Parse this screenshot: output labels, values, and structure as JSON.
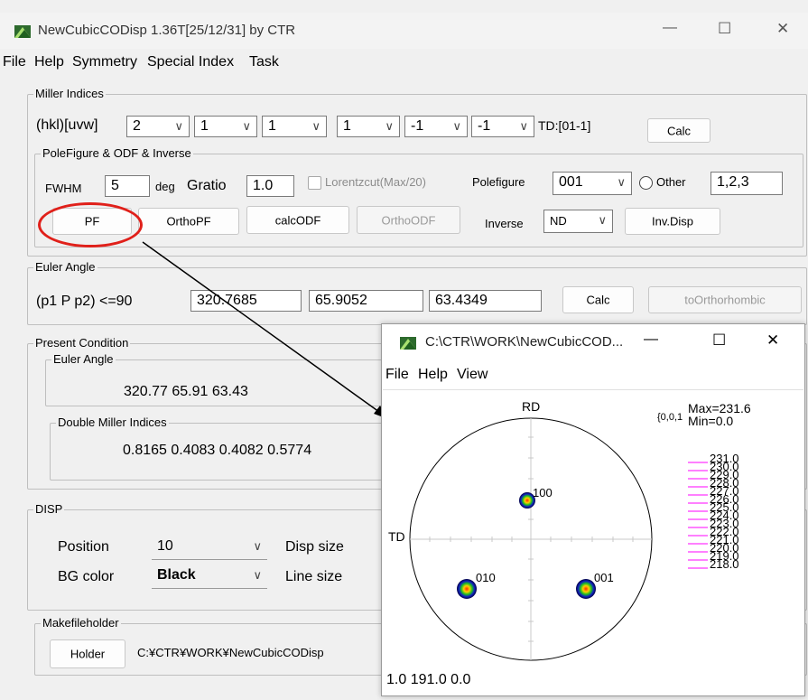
{
  "window": {
    "title": "NewCubicCODisp 1.36T[25/12/31] by CTR",
    "controls": {
      "minimize": "—",
      "maximize": "☐",
      "close": "✕"
    }
  },
  "menu": [
    "File",
    "Help",
    "Symmetry",
    "Special Index",
    "Task"
  ],
  "miller": {
    "group_title": "Miller Indices",
    "label": "(hkl)[uvw]",
    "values": [
      "2",
      "1",
      "1",
      "1",
      "-1",
      "-1"
    ],
    "td": "TD:[01-1]",
    "calc": "Calc"
  },
  "pole": {
    "group_title": "PoleFigure & ODF & Inverse",
    "fwhm_label": "FWHM",
    "fwhm_value": "5",
    "deg": "deg",
    "gratio_label": "Gratio",
    "gratio_value": "1.0",
    "lorentz_label": "Lorentzcut(Max/20)",
    "polefigure_label": "Polefigure",
    "polefigure_value": "001",
    "other_label": "Other",
    "other_value": "1,2,3",
    "pf": "PF",
    "orthopf": "OrthoPF",
    "calcodf": "calcODF",
    "orthoodf": "OrthoODF",
    "inverse_label": "Inverse",
    "inverse_value": "ND",
    "invdisp": "Inv.Disp"
  },
  "euler": {
    "group_title": "Euler Angle",
    "label": "(p1 P p2) <=90",
    "values": [
      "320.7685",
      "65.9052",
      "63.4349"
    ],
    "calc": "Calc",
    "to_ortho": "toOrthorhombic"
  },
  "present": {
    "group_title": "Present Condition",
    "euler_title": "Euler Angle",
    "euler_text": "320.77  65.91  63.43",
    "dmi_title": "Double Miller Indices",
    "dmi_text": "0.8165  0.4083  0.4082  0.5774"
  },
  "disp": {
    "group_title": "DISP",
    "position_label": "Position",
    "position_value": "10",
    "dispsize_label": "Disp size",
    "bgcolor_label": "BG color",
    "bgcolor_value": "Black",
    "linesize_label": "Line size"
  },
  "holder": {
    "group_title": "Makefileholder",
    "button": "Holder",
    "path": "C:¥CTR¥WORK¥NewCubicCODisp"
  },
  "child": {
    "title": "C:\\CTR\\WORK\\NewCubicCOD...",
    "controls": {
      "minimize": "—",
      "maximize": "☐",
      "close": "✕"
    },
    "menu": [
      "File",
      "Help",
      "View"
    ],
    "rd": "RD",
    "td": "TD",
    "coord": "{0,0,1",
    "max": "Max=231.6",
    "min": "Min=0.0",
    "poles": [
      "100",
      "010",
      "001"
    ],
    "legend": [
      "231.0",
      "230.0",
      "229.0",
      "228.0",
      "227.0",
      "226.0",
      "225.0",
      "224.0",
      "223.0",
      "222.0",
      "221.0",
      "220.0",
      "219.0",
      "218.0"
    ],
    "status": "1.0  191.0  0.0",
    "legend_color": "#ff00ff"
  },
  "annotation_color": "#e0201a"
}
